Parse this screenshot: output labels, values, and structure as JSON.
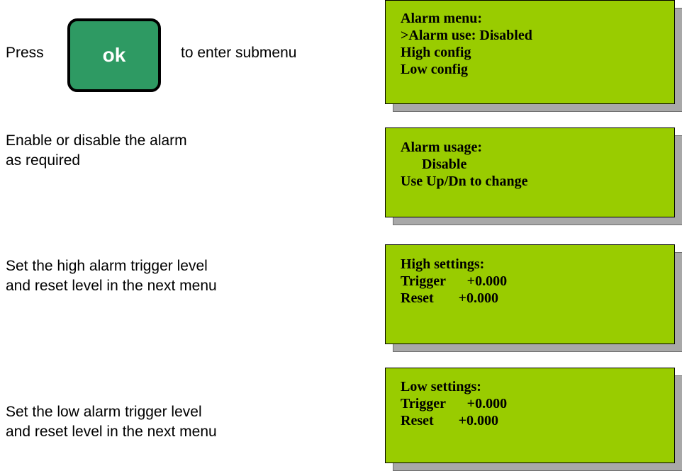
{
  "steps": [
    {
      "text_before": "Press",
      "button_label": "ok",
      "text_after": "to enter submenu",
      "screen": [
        "Alarm menu:",
        ">Alarm use: Disabled",
        "High config",
        "Low config"
      ]
    },
    {
      "lines": [
        "Enable or disable the alarm",
        "as required"
      ],
      "screen": [
        "Alarm usage:",
        "      Disable",
        "",
        "Use Up/Dn to change"
      ]
    },
    {
      "lines": [
        "Set the high alarm trigger level",
        "and reset level in the next menu"
      ],
      "screen": [
        "High settings:",
        "Trigger      +0.000",
        "Reset       +0.000"
      ]
    },
    {
      "lines": [
        "Set the low alarm trigger level",
        "and reset level in the next menu"
      ],
      "screen": [
        "Low settings:",
        "Trigger      +0.000",
        "Reset       +0.000"
      ]
    }
  ]
}
